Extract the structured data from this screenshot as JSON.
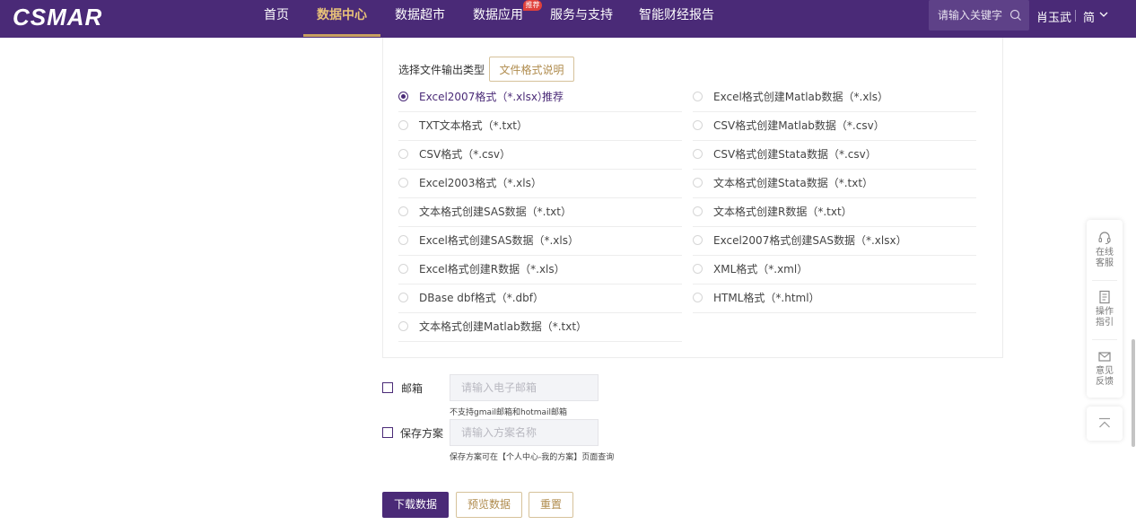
{
  "header": {
    "logo": "CSMAR",
    "nav": [
      "首页",
      "数据中心",
      "数据超市",
      "数据应用",
      "服务与支持",
      "智能财经报告"
    ],
    "active_nav": "数据中心",
    "hot_badge": "推荐",
    "search_placeholder": "请输入关键字",
    "user_name": "肖玉武",
    "language": "简"
  },
  "format_section": {
    "label": "选择文件输出类型",
    "help_button": "文件格式说明",
    "recommend_tag": "推荐",
    "selected": "Excel2007格式（*.xlsx）",
    "left_options": [
      "Excel2007格式（*.xlsx）",
      "TXT文本格式（*.txt）",
      "CSV格式（*.csv）",
      "Excel2003格式（*.xls）",
      "文本格式创建SAS数据（*.txt）",
      "Excel格式创建SAS数据（*.xls）",
      "Excel格式创建R数据（*.xls）",
      "DBase dbf格式（*.dbf）",
      "文本格式创建Matlab数据（*.txt）"
    ],
    "right_options": [
      "Excel格式创建Matlab数据（*.xls）",
      "CSV格式创建Matlab数据（*.csv）",
      "CSV格式创建Stata数据（*.csv）",
      "文本格式创建Stata数据（*.txt）",
      "文本格式创建R数据（*.txt）",
      "Excel2007格式创建SAS数据（*.xlsx）",
      "XML格式（*.xml）",
      "HTML格式（*.html）"
    ]
  },
  "email": {
    "label": "邮箱",
    "placeholder": "请输入电子邮箱",
    "hint": "不支持gmail邮箱和hotmail邮箱",
    "checked": false
  },
  "scheme": {
    "label": "保存方案",
    "placeholder": "请输入方案名称",
    "hint": "保存方案可在【个人中心-我的方案】页面查询",
    "checked": false
  },
  "actions": {
    "download": "下载数据",
    "preview": "预览数据",
    "reset": "重置"
  },
  "float_bar": {
    "service": "在线客服",
    "guide": "操作指引",
    "feedback": "意见反馈"
  },
  "colors": {
    "brand": "#4a2a77",
    "gold": "#b08c4e",
    "badge": "#e0413c"
  }
}
